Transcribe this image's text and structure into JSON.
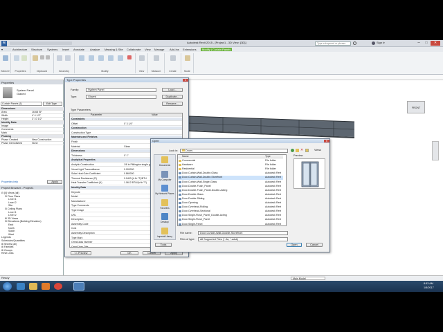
{
  "app": {
    "title": "Autodesk Revit 2015 - [Project1 - 3D View: {3D}]",
    "search_placeholder": "Type a keyword or phrase",
    "sign_in": "Sign In"
  },
  "ribbon": {
    "tabs": [
      "Architecture",
      "Structure",
      "Systems",
      "Insert",
      "Annotate",
      "Analyze",
      "Massing & Site",
      "Collaborate",
      "View",
      "Manage",
      "Add-Ins",
      "Extensions",
      "Modify | Curtain Panels"
    ],
    "active_tab": "Modify | Curtain Panels",
    "groups": [
      "Select",
      "Properties",
      "Clipboard",
      "Geometry",
      "Modify",
      "View",
      "Measure",
      "Create",
      "Mode"
    ],
    "select_label": "Select ▾"
  },
  "properties": {
    "header": "Properties",
    "family": "System Panel",
    "type": "Glazed",
    "selector": "Curtain Panels (1)",
    "edit_type": "Edit Type",
    "rows": [
      {
        "k": "Dimensions",
        "v": "",
        "group": true
      },
      {
        "k": "Area",
        "v": "16.68 SF"
      },
      {
        "k": "Width",
        "v": "4' 4 1/2\""
      },
      {
        "k": "Height",
        "v": "3' 10 1/2\""
      },
      {
        "k": "Identity Data",
        "v": "",
        "group": true
      },
      {
        "k": "Image",
        "v": ""
      },
      {
        "k": "Comments",
        "v": ""
      },
      {
        "k": "Mark",
        "v": ""
      },
      {
        "k": "Phasing",
        "v": "",
        "group": true
      },
      {
        "k": "Phase Created",
        "v": "New Construction"
      },
      {
        "k": "Phase Demolished",
        "v": "None"
      }
    ],
    "help": "Properties help",
    "apply": "Apply"
  },
  "browser": {
    "header": "Project Browser - Project1",
    "items": [
      {
        "t": "⊟ [0] Views (all)",
        "d": 0
      },
      {
        "t": "⊟ Floor Plans",
        "d": 1
      },
      {
        "t": "Level 1",
        "d": 2
      },
      {
        "t": "Level 2",
        "d": 2
      },
      {
        "t": "Site",
        "d": 2
      },
      {
        "t": "⊟ Ceiling Plans",
        "d": 1
      },
      {
        "t": "Level 1",
        "d": 2
      },
      {
        "t": "Level 2",
        "d": 2
      },
      {
        "t": "⊞ 3D Views",
        "d": 1
      },
      {
        "t": "⊟ Elevations (Building Elevation)",
        "d": 1
      },
      {
        "t": "East",
        "d": 2
      },
      {
        "t": "North",
        "d": 2
      },
      {
        "t": "South",
        "d": 2
      },
      {
        "t": "West",
        "d": 2
      },
      {
        "t": "Legends",
        "d": 0
      },
      {
        "t": "Schedules/Quantities",
        "d": 0
      },
      {
        "t": "⊞ Sheets (all)",
        "d": 0
      },
      {
        "t": "⊞ Families",
        "d": 0
      },
      {
        "t": "⊞ Groups",
        "d": 0
      },
      {
        "t": "Revit Links",
        "d": 0
      }
    ]
  },
  "type_properties": {
    "title": "Type Properties",
    "family_label": "Family:",
    "family_value": "System Panel",
    "type_label": "Type:",
    "type_value": "Glazed",
    "load": "Load...",
    "duplicate": "Duplicate...",
    "rename": "Rename...",
    "type_params": "Type Parameters",
    "col_param": "Parameter",
    "col_value": "Value",
    "rows": [
      {
        "k": "Constraints",
        "v": "",
        "group": true
      },
      {
        "k": "Offset",
        "v": "0' 3 1/4\""
      },
      {
        "k": "Construction",
        "v": "",
        "group": true
      },
      {
        "k": "Construction Type",
        "v": ""
      },
      {
        "k": "Materials and Finishes",
        "v": "",
        "group": true
      },
      {
        "k": "Finish",
        "v": ""
      },
      {
        "k": "Material",
        "v": "Glass"
      },
      {
        "k": "Dimensions",
        "v": "",
        "group": true
      },
      {
        "k": "Thickness",
        "v": "0' 1\""
      },
      {
        "k": "Analytical Properties",
        "v": "",
        "group": true
      },
      {
        "k": "Analytic Construction",
        "v": "1/8 in Pilkington single glazing"
      },
      {
        "k": "Visual Light Transmittance",
        "v": "0.900000"
      },
      {
        "k": "Solar Heat Gain Coefficient",
        "v": "0.860000"
      },
      {
        "k": "Thermal Resistance (R)",
        "v": "0.9403 (h·ft²·°F)/BTU"
      },
      {
        "k": "Heat Transfer Coefficient (U)",
        "v": "1.0612 BTU/(h·ft²·°F)"
      },
      {
        "k": "Identity Data",
        "v": "",
        "group": true
      },
      {
        "k": "Keynote",
        "v": ""
      },
      {
        "k": "Model",
        "v": ""
      },
      {
        "k": "Manufacturer",
        "v": ""
      },
      {
        "k": "Type Comments",
        "v": ""
      },
      {
        "k": "Type Image",
        "v": ""
      },
      {
        "k": "URL",
        "v": ""
      },
      {
        "k": "Description",
        "v": ""
      },
      {
        "k": "Assembly Code",
        "v": ""
      },
      {
        "k": "Cost",
        "v": ""
      },
      {
        "k": "Assembly Description",
        "v": ""
      },
      {
        "k": "Type Mark",
        "v": ""
      },
      {
        "k": "OmniClass Number",
        "v": ""
      },
      {
        "k": "OmniClass Title",
        "v": ""
      }
    ],
    "preview": "<< Preview",
    "ok": "OK",
    "cancel": "Cancel",
    "apply": "Apply"
  },
  "open_dialog": {
    "title": "Open",
    "look_in_label": "Look in:",
    "look_in": "Doors",
    "views": "Views",
    "preview_label": "Preview",
    "col_name": "Name",
    "col_type": "Type",
    "places": [
      "Documents",
      "My Computer",
      "My Network Places",
      "Favorites",
      "Desktop",
      "Imperial Library"
    ],
    "files": [
      {
        "n": "Commercial",
        "ty": "File folder",
        "f": true
      },
      {
        "n": "Hardware",
        "ty": "File folder",
        "f": true
      },
      {
        "n": "Residential",
        "ty": "File folder",
        "f": true
      },
      {
        "n": "Door-Curtain-Wall-Double-Glass",
        "ty": "Autodesk Revi"
      },
      {
        "n": "Door-Curtain-Wall-Double-Storefront",
        "ty": "Autodesk Revi",
        "sel": true
      },
      {
        "n": "Door-Curtain-Wall-Single-Glass",
        "ty": "Autodesk Revi"
      },
      {
        "n": "Door-Double-Flush_Panel",
        "ty": "Autodesk Revi"
      },
      {
        "n": "Door-Double-Flush_Panel-Double-Acting",
        "ty": "Autodesk Revi"
      },
      {
        "n": "Door-Double-Glass",
        "ty": "Autodesk Revi"
      },
      {
        "n": "Door-Double-Sliding",
        "ty": "Autodesk Revi"
      },
      {
        "n": "Door-Opening",
        "ty": "Autodesk Revi"
      },
      {
        "n": "Door-Overhead-Rolling",
        "ty": "Autodesk Revi"
      },
      {
        "n": "Door-Overhead-Sectional",
        "ty": "Autodesk Revi"
      },
      {
        "n": "Door-Single-Flush_Panel_Double-Acting",
        "ty": "Autodesk Revi"
      },
      {
        "n": "Door-Single-Flush_Panel",
        "ty": "Autodesk Revi"
      },
      {
        "n": "Door-Single-Panel",
        "ty": "Autodesk Revi"
      }
    ],
    "file_name_label": "File name:",
    "file_name": "Door-Curtain-Wall-Double-Storefront",
    "files_type_label": "Files of type:",
    "files_type": "All Supported Files (*.rfa, *.adsk)",
    "tools": "Tools",
    "open": "Open",
    "cancel": "Cancel"
  },
  "status": {
    "text": "Ready",
    "model": "Main Model",
    "time": "8:53 AM",
    "date": "1/8/2017"
  },
  "viewcube": "FRONT",
  "colors": {
    "accent": "#6db33f",
    "selection": "#cde3fb"
  }
}
